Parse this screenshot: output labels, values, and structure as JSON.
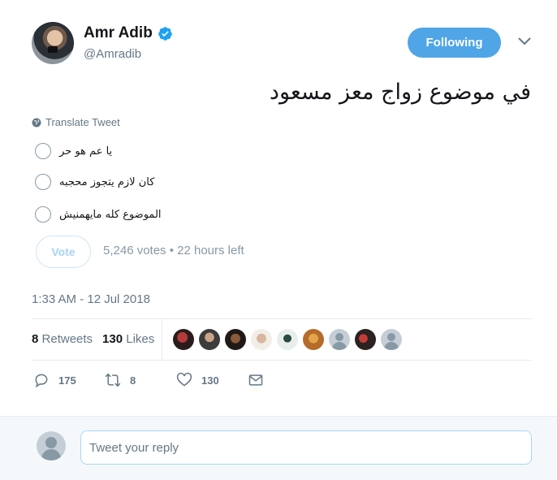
{
  "author": {
    "display_name": "Amr Adib",
    "handle": "@Amradib",
    "verified": true,
    "follow_label": "Following"
  },
  "tweet": {
    "text": "في موضوع زواج معز مسعود",
    "translate_label": "Translate Tweet",
    "timestamp": "1:33 AM - 12 Jul 2018"
  },
  "poll": {
    "options": [
      "يا عم هو حر",
      "كان لازم يتجوز محجبه",
      "الموضوع كله مايهمنيش"
    ],
    "vote_label": "Vote",
    "meta": "5,246 votes • 22 hours left"
  },
  "stats": {
    "retweets_count": "8",
    "retweets_label": "Retweets",
    "likes_count": "130",
    "likes_label": "Likes"
  },
  "actions": {
    "reply_count": "175",
    "retweet_count": "8",
    "like_count": "130"
  },
  "reply": {
    "placeholder": "Tweet your reply"
  },
  "colors": {
    "accent": "#4fa5e5",
    "muted": "#657786"
  }
}
